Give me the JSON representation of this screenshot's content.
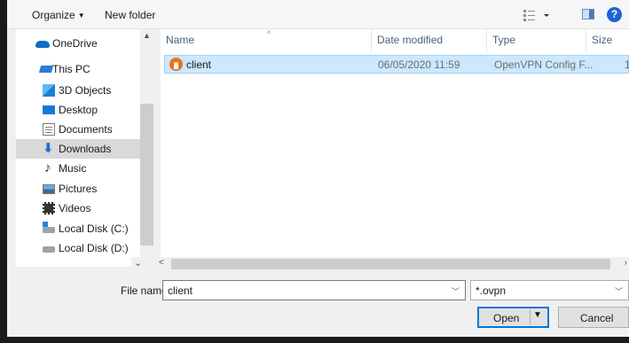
{
  "toolbar": {
    "organize_label": "Organize",
    "new_folder_label": "New folder",
    "help_label": "?"
  },
  "nav": {
    "items": [
      {
        "label": "OneDrive",
        "icon": "onedrive-icon"
      },
      {
        "label": "This PC",
        "icon": "computer-icon"
      },
      {
        "label": "3D Objects",
        "icon": "3d-objects-icon"
      },
      {
        "label": "Desktop",
        "icon": "desktop-icon"
      },
      {
        "label": "Documents",
        "icon": "documents-icon"
      },
      {
        "label": "Downloads",
        "icon": "downloads-icon",
        "selected": true
      },
      {
        "label": "Music",
        "icon": "music-icon"
      },
      {
        "label": "Pictures",
        "icon": "pictures-icon"
      },
      {
        "label": "Videos",
        "icon": "videos-icon"
      },
      {
        "label": "Local Disk (C:)",
        "icon": "local-disk-icon"
      },
      {
        "label": "Local Disk (D:)",
        "icon": "local-disk-icon"
      }
    ]
  },
  "columns": {
    "name": "Name",
    "date_modified": "Date modified",
    "type": "Type",
    "size": "Size"
  },
  "files": [
    {
      "name": "client",
      "date_modified": "06/05/2020 11:59",
      "type": "OpenVPN Config F...",
      "size": "1",
      "icon": "openvpn-icon",
      "selected": true
    }
  ],
  "footer": {
    "file_name_label": "File name:",
    "file_name_value": "client",
    "file_type_value": "*.ovpn",
    "open_label": "Open",
    "cancel_label": "Cancel"
  },
  "colors": {
    "selection": "#cce8ff",
    "nav_selected": "#d9d9d9",
    "accent": "#0078d7"
  }
}
